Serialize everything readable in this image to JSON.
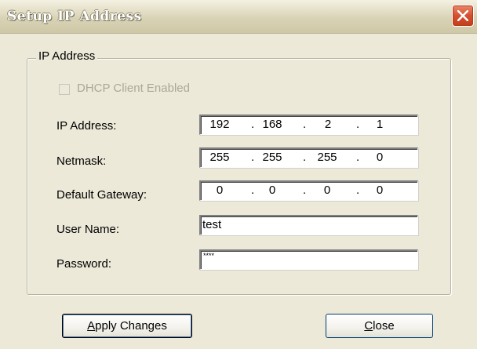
{
  "window": {
    "title": "Setup IP Address"
  },
  "group": {
    "label": "IP Address"
  },
  "dhcp": {
    "label": "DHCP Client Enabled",
    "checked": false,
    "enabled": false
  },
  "fields": {
    "ip_address": {
      "label": "IP Address:",
      "octets": [
        "192",
        "168",
        "2",
        "1"
      ]
    },
    "netmask": {
      "label": "Netmask:",
      "octets": [
        "255",
        "255",
        "255",
        "0"
      ]
    },
    "gateway": {
      "label": "Default Gateway:",
      "octets": [
        "0",
        "0",
        "0",
        "0"
      ]
    },
    "user_name": {
      "label": "User Name:",
      "value": "test"
    },
    "password": {
      "label": "Password:",
      "value": "****"
    }
  },
  "buttons": {
    "apply": {
      "mnemonic": "A",
      "rest": "pply Changes"
    },
    "close": {
      "mnemonic": "C",
      "rest": "lose"
    }
  },
  "icons": {
    "close": "close-icon"
  },
  "colors": {
    "dialog_bg": "#ece9d8",
    "close_button": "#d4502e",
    "disabled_text": "#aca899"
  }
}
